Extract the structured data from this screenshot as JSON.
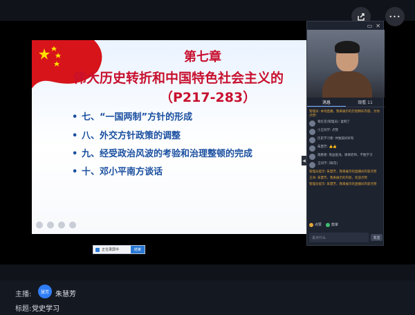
{
  "top": {
    "share_icon": "share-icon",
    "more_icon": "more-dots-icon",
    "more_label": "•••"
  },
  "slide": {
    "chapter": "第七章",
    "subtitle": "伟大历史转折和中国特色社会主义的",
    "pages": "（P217-283）",
    "bullets": [
      "七、“一国两制”方针的形成",
      "八、外交方针政策的调整",
      "九、经受政治风波的考验和治理整顿的完成",
      "十、邓小平南方谈话"
    ]
  },
  "taskbar": {
    "label": "正在录屏中",
    "button": "结束"
  },
  "panel": {
    "tabs": [
      "消息",
      "观看 11"
    ],
    "messages": [
      {
        "name": "",
        "text": "管理员: 本场直播，我来展示的历程精彩内容，为你点赞!",
        "system": true
      },
      {
        "name": "",
        "text": "蒋红花(管理员): 复制了",
        "system": false
      },
      {
        "name": "",
        "text": "小王同学: 点赞",
        "system": false
      },
      {
        "name": "",
        "text": "历史学习者: 共勉美好好有",
        "system": false
      },
      {
        "name": "",
        "text": "朱慧芳: 👍👍",
        "system": false
      },
      {
        "name": "",
        "text": "观看者: 受益匪浅，谢谢老师，不胜学习",
        "system": false
      },
      {
        "name": "",
        "text": "王同学: [鲜花]",
        "system": false
      },
      {
        "name": "",
        "text": "管理员提示: 朱慧芳，我来展示的直播间内容点赞",
        "system": true
      },
      {
        "name": "",
        "text": "王涛: 朱慧芳，我来展示的内容，欢迎点赞",
        "system": true
      },
      {
        "name": "",
        "text": "管理员提示: 朱慧芳，我来展示的直播间内容点赞",
        "system": true
      }
    ],
    "reactions": [
      {
        "label": "点赞",
        "color": "#e0a73a"
      },
      {
        "label": "鼓掌",
        "color": "#3fbf6f"
      }
    ],
    "input_placeholder": "说点什么",
    "send_label": "发送"
  },
  "info": {
    "host_label": "主播:",
    "host_avatar": "慧芳",
    "host_name": "朱慧芳",
    "topic_label": "标题:",
    "topic_name": "党史学习"
  }
}
